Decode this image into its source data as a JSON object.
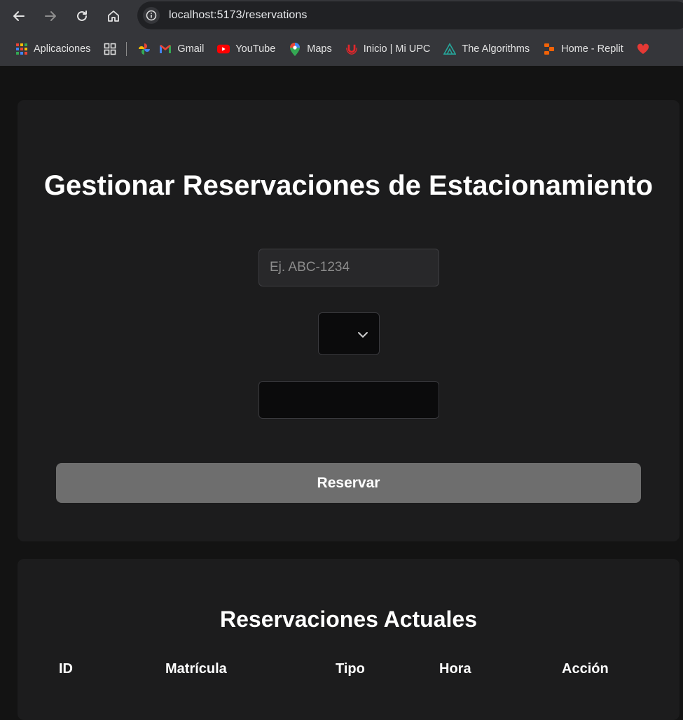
{
  "browser": {
    "url": "localhost:5173/reservations",
    "bookmarks": [
      {
        "icon": "apps-grid-icon",
        "label": "Aplicaciones"
      },
      {
        "icon": "tab-groups-icon",
        "label": ""
      },
      {
        "icon": "google-photos-icon",
        "label": ""
      },
      {
        "icon": "gmail-icon",
        "label": "Gmail"
      },
      {
        "icon": "youtube-icon",
        "label": "YouTube"
      },
      {
        "icon": "maps-icon",
        "label": "Maps"
      },
      {
        "icon": "upc-icon",
        "label": "Inicio | Mi UPC"
      },
      {
        "icon": "algorithms-icon",
        "label": "The Algorithms"
      },
      {
        "icon": "replit-icon",
        "label": "Home - Replit"
      }
    ]
  },
  "form": {
    "title": "Gestionar Reservaciones de Estacionamiento",
    "plate_placeholder": "Ej. ABC-1234",
    "plate_value": "",
    "type_value": "",
    "time_value": "",
    "submit_label": "Reservar"
  },
  "reservations": {
    "title": "Reservaciones Actuales",
    "columns": [
      "ID",
      "Matrícula",
      "Tipo",
      "Hora",
      "Acción"
    ],
    "rows": []
  },
  "colors": {
    "page_bg": "#131313",
    "card_bg": "#1c1c1d",
    "button_bg": "#6e6e6e",
    "chrome_bg": "#35363a"
  }
}
